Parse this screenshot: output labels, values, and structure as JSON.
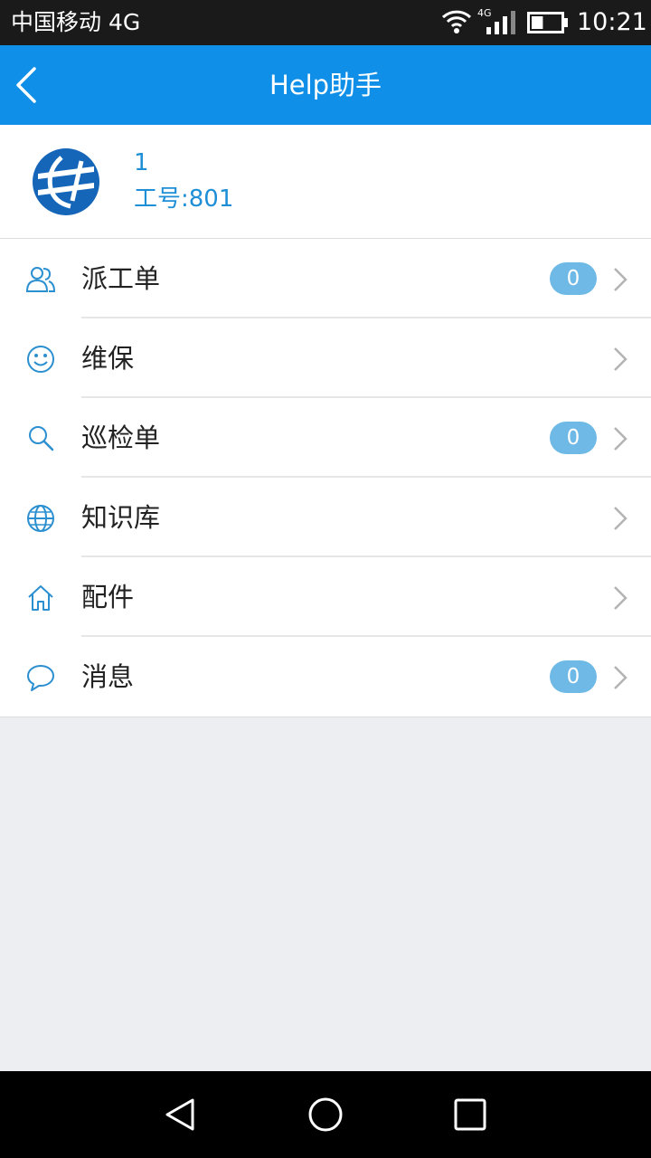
{
  "status_bar": {
    "carrier": "中国移动 4G",
    "network": "4G",
    "time": "10:21",
    "battery_level": 0.4
  },
  "header": {
    "title": "Help助手",
    "back_icon": "chevron-left-icon",
    "background_color": "#0f8fe8"
  },
  "profile": {
    "name": "1",
    "employee_id": "工号:801",
    "avatar_icon": "company-logo-icon"
  },
  "menu": {
    "items": [
      {
        "label": "派工单",
        "icon": "users-icon",
        "badge": "0"
      },
      {
        "label": "维保",
        "icon": "smiley-icon"
      },
      {
        "label": "巡检单",
        "icon": "search-icon",
        "badge": "0"
      },
      {
        "label": "知识库",
        "icon": "globe-icon"
      },
      {
        "label": "配件",
        "icon": "home-icon"
      },
      {
        "label": "消息",
        "icon": "chat-bubble-icon",
        "badge": "0"
      }
    ]
  },
  "colors": {
    "accent": "#0f8fe8",
    "badge": "#6fb9e6",
    "icon": "#2b8fd0"
  },
  "nav_bar": {
    "icons": [
      "triangle-back-icon",
      "circle-home-icon",
      "square-recent-icon"
    ]
  }
}
